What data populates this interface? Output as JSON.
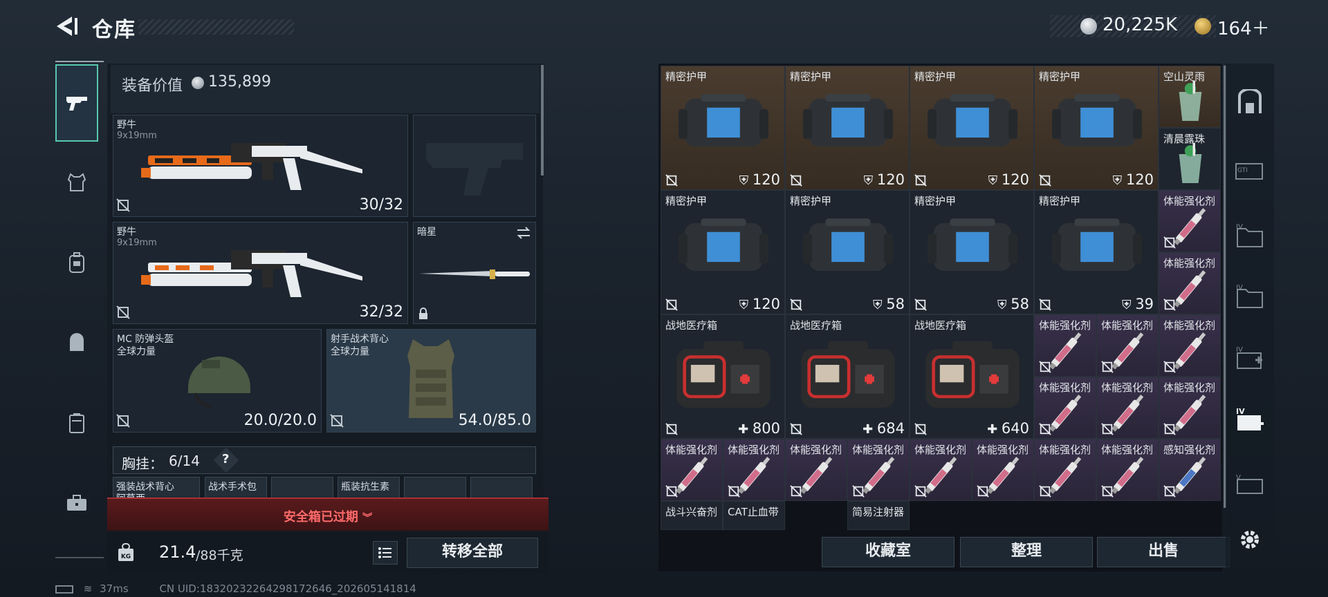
{
  "header": {
    "title": "仓库",
    "currency": "20,225K",
    "tokens": "164＋"
  },
  "left_nav": {
    "icons": [
      "pistol-icon",
      "vest-icon",
      "backpack-icon",
      "pack-icon",
      "case-icon",
      "toolbox-icon"
    ]
  },
  "equipment": {
    "value_label": "装备价值",
    "value": "135,899",
    "primary_1": {
      "name": "野牛",
      "ammo": "9x19mm",
      "count": "30/32"
    },
    "primary_2": {
      "name": "野牛",
      "ammo": "9x19mm",
      "count": "32/32"
    },
    "melee": {
      "name": "暗星"
    },
    "helmet": {
      "name": "MC 防弹头盔",
      "faction": "全球力量",
      "durability": "20.0/20.0"
    },
    "armor": {
      "name": "射手战术背心",
      "faction": "全球力量",
      "durability": "54.0/85.0"
    },
    "chest_rig": {
      "label": "胸挂：",
      "capacity": "6/14",
      "help": "?"
    },
    "chest_slots": [
      "强装战术背心",
      "战术手术包",
      "",
      "瓶装抗生素",
      "",
      ""
    ],
    "partial_label": "阿莫西",
    "safe_box_expired": "安全箱已过期",
    "weight": "21.4",
    "weight_unit": "/88千克",
    "transfer_all": "转移全部"
  },
  "stash": {
    "items": [
      {
        "name": "精密护甲",
        "dur": "120",
        "kind": "armor"
      },
      {
        "name": "精密护甲",
        "dur": "120",
        "kind": "armor"
      },
      {
        "name": "精密护甲",
        "dur": "120",
        "kind": "armor"
      },
      {
        "name": "精密护甲",
        "dur": "120",
        "kind": "armor"
      },
      {
        "name": "空山灵雨",
        "dur": "",
        "kind": "drink"
      },
      {
        "name": "清晨露珠",
        "dur": "",
        "kind": "drink"
      },
      {
        "name": "精密护甲",
        "dur": "120",
        "kind": "armor"
      },
      {
        "name": "精密护甲",
        "dur": "58",
        "kind": "armor"
      },
      {
        "name": "精密护甲",
        "dur": "58",
        "kind": "armor"
      },
      {
        "name": "精密护甲",
        "dur": "39",
        "kind": "armor"
      },
      {
        "name": "体能强化剂",
        "dur": "",
        "kind": "syringe"
      },
      {
        "name": "体能强化剂",
        "dur": "",
        "kind": "syringe"
      },
      {
        "name": "战地医疗箱",
        "dur": "800",
        "kind": "medkit"
      },
      {
        "name": "战地医疗箱",
        "dur": "684",
        "kind": "medkit"
      },
      {
        "name": "战地医疗箱",
        "dur": "640",
        "kind": "medkit"
      },
      {
        "name": "体能强化剂",
        "dur": "",
        "kind": "syringe"
      },
      {
        "name": "体能强化剂",
        "dur": "",
        "kind": "syringe"
      },
      {
        "name": "体能强化剂",
        "dur": "",
        "kind": "syringe"
      },
      {
        "name": "体能强化剂",
        "dur": "",
        "kind": "syringe"
      },
      {
        "name": "体能强化剂",
        "dur": "",
        "kind": "syringe"
      },
      {
        "name": "体能强化剂",
        "dur": "",
        "kind": "syringe"
      },
      {
        "name": "体能强化剂",
        "dur": "",
        "kind": "syringe"
      },
      {
        "name": "体能强化剂",
        "dur": "",
        "kind": "syringe"
      },
      {
        "name": "体能强化剂",
        "dur": "",
        "kind": "syringe"
      },
      {
        "name": "体能强化剂",
        "dur": "",
        "kind": "syringe"
      },
      {
        "name": "体能强化剂",
        "dur": "",
        "kind": "syringe"
      },
      {
        "name": "体能强化剂",
        "dur": "",
        "kind": "syringe"
      },
      {
        "name": "体能强化剂",
        "dur": "",
        "kind": "syringe"
      },
      {
        "name": "体能强化剂",
        "dur": "",
        "kind": "syringe"
      },
      {
        "name": "感知强化剂",
        "dur": "",
        "kind": "syringe-blue"
      },
      {
        "name": "战斗兴奋剂",
        "dur": "",
        "kind": "syringe"
      },
      {
        "name": "CAT止血带",
        "dur": "",
        "kind": "tourniquet"
      },
      {
        "name": "简易注射器",
        "dur": "",
        "kind": "syringe"
      }
    ],
    "btn_collection": "收藏室",
    "btn_sort": "整理",
    "btn_sell": "出售"
  },
  "right_nav": {
    "icons": [
      "exit-icon",
      "gti-case-icon",
      "iv-folder-icon",
      "iv-folder-icon-2",
      "iv-medkit-icon",
      "iv-medkit-selected-icon",
      "v-case-icon",
      "settings-icon"
    ],
    "labels": [
      "GTI",
      "IV",
      "IV",
      "IV",
      "IV",
      "V"
    ]
  },
  "footer": {
    "ping": "37ms",
    "uid": "CN UID:18320232264298172646_202605141814"
  },
  "colors": {
    "accent_teal": "#58c8b0",
    "warn_red": "#ff6b6b",
    "armor_blue": "#3f8fd6",
    "brown_cell": "#4a3c2f"
  }
}
